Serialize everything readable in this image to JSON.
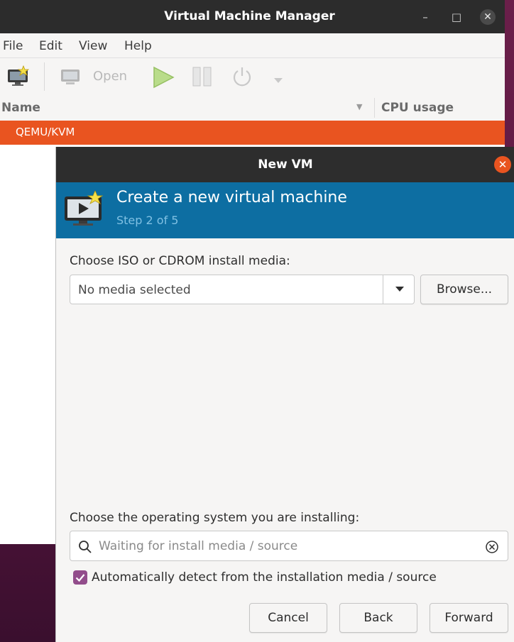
{
  "main_window": {
    "title": "Virtual Machine Manager",
    "controls": {
      "minimize": "–",
      "maximize": "□",
      "close": "✕"
    },
    "menu": [
      "File",
      "Edit",
      "View",
      "Help"
    ],
    "toolbar": {
      "new_vm_icon": "monitor-star-icon",
      "open_label": "Open",
      "run_icon": "play-icon",
      "pause_icon": "pause-icon",
      "shutdown_icon": "power-icon"
    },
    "columns": {
      "name": "Name",
      "cpu": "CPU usage"
    },
    "rows": [
      {
        "label": "QEMU/KVM",
        "selected": true
      }
    ],
    "accent": "#e95420"
  },
  "dialog": {
    "title": "New VM",
    "close": "✕",
    "banner": {
      "title": "Create a new virtual machine",
      "step": "Step 2 of 5",
      "color": "#0d6ea2"
    },
    "media_label": "Choose ISO or CDROM install media:",
    "media_value": "No media selected",
    "browse": "Browse...",
    "os_label": "Choose the operating system you are installing:",
    "os_placeholder": "Waiting for install media / source",
    "auto_detect": {
      "label": "Automatically detect from the installation media / source",
      "checked": true
    },
    "buttons": {
      "cancel": "Cancel",
      "back": "Back",
      "forward": "Forward"
    }
  }
}
